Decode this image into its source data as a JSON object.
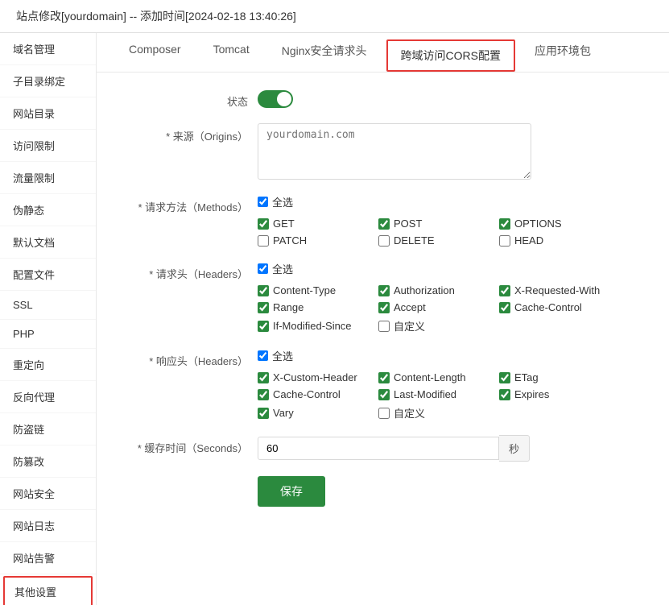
{
  "header": {
    "title": "站点修改[yourdomain] -- 添加时间[2024-02-18 13:40:26]"
  },
  "sidebar": {
    "items": [
      {
        "label": "域名管理",
        "id": "domain"
      },
      {
        "label": "子目录绑定",
        "id": "subdir"
      },
      {
        "label": "网站目录",
        "id": "webdir"
      },
      {
        "label": "访问限制",
        "id": "access"
      },
      {
        "label": "流量限制",
        "id": "traffic"
      },
      {
        "label": "伪静态",
        "id": "rewrite"
      },
      {
        "label": "默认文档",
        "id": "default-doc"
      },
      {
        "label": "配置文件",
        "id": "config"
      },
      {
        "label": "SSL",
        "id": "ssl"
      },
      {
        "label": "PHP",
        "id": "php"
      },
      {
        "label": "重定向",
        "id": "redirect"
      },
      {
        "label": "反向代理",
        "id": "proxy"
      },
      {
        "label": "防盗链",
        "id": "hotlink"
      },
      {
        "label": "防篡改",
        "id": "tamper"
      },
      {
        "label": "网站安全",
        "id": "security"
      },
      {
        "label": "网站日志",
        "id": "log"
      },
      {
        "label": "网站告警",
        "id": "alert"
      },
      {
        "label": "其他设置",
        "id": "other",
        "highlighted": true
      }
    ]
  },
  "tabs": [
    {
      "label": "Composer",
      "id": "composer"
    },
    {
      "label": "Tomcat",
      "id": "tomcat"
    },
    {
      "label": "Nginx安全请求头",
      "id": "nginx-security"
    },
    {
      "label": "跨域访问CORS配置",
      "id": "cors",
      "active": true
    },
    {
      "label": "应用环境包",
      "id": "env-package"
    }
  ],
  "form": {
    "status_label": "状态",
    "origin_label": "* 来源（Origins）",
    "origin_placeholder": "yourdomain.com",
    "methods_label": "* 请求方法（Methods）",
    "headers_label": "* 请求头（Headers）",
    "response_headers_label": "* 响应头（Headers）",
    "cache_label": "* 缓存时间（Seconds）",
    "cache_value": "60",
    "cache_suffix": "秒",
    "select_all": "全选",
    "methods": [
      {
        "label": "GET",
        "checked": true
      },
      {
        "label": "POST",
        "checked": true
      },
      {
        "label": "OPTIONS",
        "checked": true
      },
      {
        "label": "PATCH",
        "checked": false
      },
      {
        "label": "DELETE",
        "checked": false
      },
      {
        "label": "HEAD",
        "checked": false
      }
    ],
    "req_headers": [
      {
        "label": "Content-Type",
        "checked": true
      },
      {
        "label": "Authorization",
        "checked": true
      },
      {
        "label": "X-Requested-With",
        "checked": true
      },
      {
        "label": "Range",
        "checked": true
      },
      {
        "label": "Accept",
        "checked": true
      },
      {
        "label": "Cache-Control",
        "checked": true
      },
      {
        "label": "If-Modified-Since",
        "checked": true
      },
      {
        "label": "自定义",
        "checked": false
      }
    ],
    "resp_headers": [
      {
        "label": "X-Custom-Header",
        "checked": true
      },
      {
        "label": "Content-Length",
        "checked": true
      },
      {
        "label": "ETag",
        "checked": true
      },
      {
        "label": "Cache-Control",
        "checked": true
      },
      {
        "label": "Last-Modified",
        "checked": true
      },
      {
        "label": "Expires",
        "checked": true
      },
      {
        "label": "Vary",
        "checked": true
      },
      {
        "label": "自定义",
        "checked": false
      }
    ],
    "save_label": "保存"
  },
  "colors": {
    "green": "#2b8a3e",
    "red": "#e53935"
  }
}
